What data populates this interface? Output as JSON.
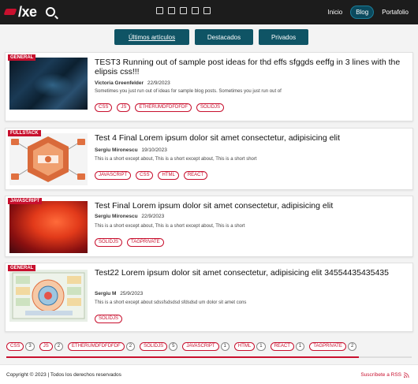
{
  "header": {
    "logo_text": "/xe",
    "nav": [
      "Inicio",
      "Blog",
      "Portafolio"
    ],
    "social_icons": [
      "mail-icon",
      "document-icon",
      "linkedin-icon",
      "tumblr-icon",
      "twitter-icon"
    ],
    "brand_color": "#c8102e"
  },
  "tabs": [
    "Últimos artículos",
    "Destacados",
    "Privados"
  ],
  "posts": [
    {
      "category": "GENERAL",
      "title": "TEST3 Running out of sample post ideas for thd effs sfggds eeffg in 3 lines with the elipsis css!!!",
      "author": "Victoria Greenfelder",
      "date": "22/9/2023",
      "excerpt": "Sometimes you just run out of ideas for sample blog posts. Sometimes you just run out of",
      "tags": [
        "CSS",
        "JS",
        "ETHERUMDFDFDFDF",
        "SOLIDJS"
      ]
    },
    {
      "category": "FULLSTACK",
      "title": "Test 4 Final Lorem ipsum dolor sit amet consectetur, adipisicing elit",
      "author": "Sergiu Mironescu",
      "date": "19/10/2023",
      "excerpt": "This is a short except about, This is a short except about, This is a short short",
      "tags": [
        "JAVASCRIPT",
        "CSS",
        "HTML",
        "REACT"
      ]
    },
    {
      "category": "JAVASCRIPT",
      "title": "Test Final Lorem ipsum dolor sit amet consectetur, adipisicing elit",
      "author": "Sergiu Mironescu",
      "date": "22/9/2023",
      "excerpt": "This is a short except about, This is a short except about, This is a short",
      "tags": [
        "SOLIDJS",
        "TAGPRIVATE"
      ]
    },
    {
      "category": "GENERAL",
      "title": "Test22 Lorem ipsum dolor sit amet consectetur, adipisicing elit 34554435435435",
      "author": "Sergiu M",
      "date": "25/9/2023",
      "excerpt": "This is a short except about sdssfsdsdsd sfdsdsd um dolor sit amet cons",
      "tags": [
        "SOLIDJS"
      ]
    }
  ],
  "tag_cloud": [
    {
      "name": "CSS",
      "count": "3"
    },
    {
      "name": "JS",
      "count": "2"
    },
    {
      "name": "ETHERUMDFDFDFDF",
      "count": "2"
    },
    {
      "name": "SOLIDJS",
      "count": "5"
    },
    {
      "name": "JAVASCRIPT",
      "count": "1"
    },
    {
      "name": "HTML",
      "count": "1"
    },
    {
      "name": "REACT",
      "count": "1"
    },
    {
      "name": "TAGPRIVATE",
      "count": "2"
    }
  ],
  "scroll_progress": 0.87,
  "footer": {
    "copyright": "Copyright © 2023 | Todos los derechos reservados",
    "rss": "Suscríbete a RSS"
  }
}
